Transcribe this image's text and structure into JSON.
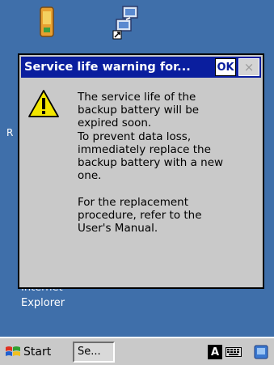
{
  "desktop": {
    "icons": [
      {
        "icon": "battery-icon"
      },
      {
        "icon": "network-icon"
      }
    ],
    "ie_label": "Explorer",
    "ie_label_partial": "Internet",
    "partial_letter": "R"
  },
  "dialog": {
    "title": "Service life warning for...",
    "ok_label": "OK",
    "close_label": "×",
    "icon": "warning-icon",
    "message_lines": [
      "The service life of the",
      "backup battery will be",
      "expired soon.",
      "To prevent data loss,",
      "immediately replace the",
      "backup battery with a new",
      "one.",
      "",
      "For the replacement",
      "procedure, refer to the",
      "User's Manual."
    ]
  },
  "taskbar": {
    "start_label": "Start",
    "task_label": "Se...",
    "input_indicator": "A",
    "keyboard_icon": "keyboard-icon",
    "desktop_icon": "show-desktop-icon"
  },
  "colors": {
    "desktop_bg": "#3f6faa",
    "titlebar": "#0a1e9e",
    "dialog_bg": "#c9c9c9"
  }
}
